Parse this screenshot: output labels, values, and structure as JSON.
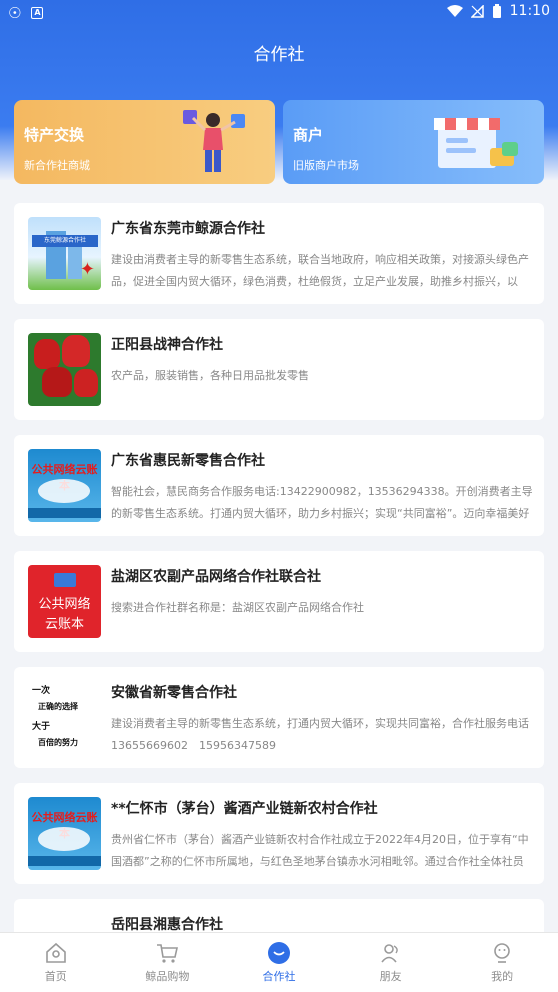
{
  "status_bar": {
    "time": "11:10",
    "battery": "1"
  },
  "header": {
    "title": "合作社"
  },
  "banners": [
    {
      "title": "特产交换",
      "subtitle": "新合作社商城"
    },
    {
      "title": "商户",
      "subtitle": "旧版商户市场"
    }
  ],
  "cards": [
    {
      "title": "广东省东莞市鲸源合作社",
      "desc": "建设由消费者主导的新零售生态系统，联合当地政府，响应相关政策，对接源头绿色产品，促进全国内贸大循环，绿色消费，杜绝假货，立足产业发展，助推乡村振兴，以人…",
      "thumb_text": "东莞鲸源合作社"
    },
    {
      "title": "正阳县战神合作社",
      "desc": "农产品，服装销售，各种日用品批发零售"
    },
    {
      "title": "广东省惠民新零售合作社",
      "desc": "智能社会，慧民商务合作服务电话:13422900982，13536294338。开创消费者主导的新零售生态系统。打通内贸大循环，助力乡村振兴；实现“共同富裕”。迈向幸福美好的明…",
      "thumb_text": "公共网络云账本"
    },
    {
      "title": "盐湖区农副产品网络合作社联合社",
      "desc": "搜索进合作社群名称是：盐湖区农副产品网络合作社",
      "thumb_line1": "公共网络",
      "thumb_line2": "云账本"
    },
    {
      "title": "安徽省新零售合作社",
      "desc": "建设消费者主导的新零售生态系统，打通内贸大循环，实现共同富裕，合作社服务电话 13655669602　15956347589",
      "thumb_lines": [
        "一次",
        "正确的选择",
        "大于",
        "百倍的努力"
      ]
    },
    {
      "title": "**仁怀市（茅台）酱酒产业链新农村合作社",
      "desc": "贵州省仁怀市（茅台）酱酒产业链新农村合作社成立于2022年4月20日，位于享有“中国酒都”之称的仁怀市所属地，与红色圣地茅台镇赤水河相毗邻。通过合作社全体社员对…",
      "thumb_text": "公共网络云账本"
    },
    {
      "title": "岳阳县湘惠合作社"
    }
  ],
  "tabs": [
    {
      "label": "首页",
      "icon": "home-icon"
    },
    {
      "label": "鲸品购物",
      "icon": "cart-icon"
    },
    {
      "label": "合作社",
      "icon": "cooperative-icon",
      "active": true
    },
    {
      "label": "朋友",
      "icon": "friends-icon"
    },
    {
      "label": "我的",
      "icon": "profile-icon"
    }
  ],
  "colors": {
    "primary": "#2f6ee6",
    "banner_orange": "#f4b860",
    "banner_blue": "#5a9cf6"
  }
}
